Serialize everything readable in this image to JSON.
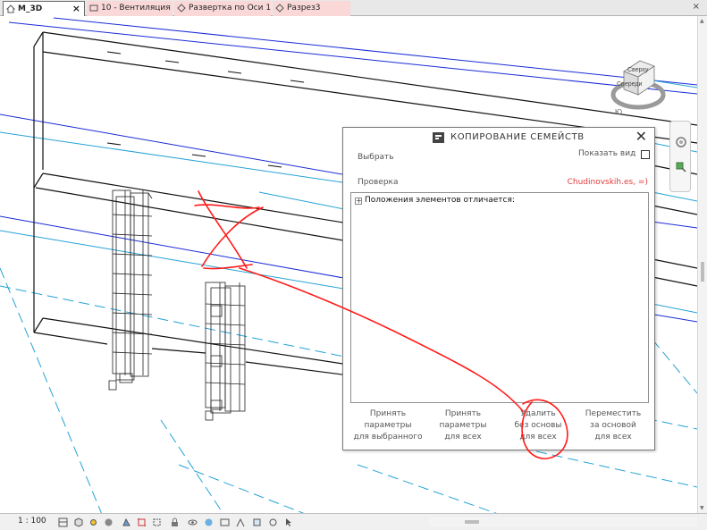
{
  "tabs": [
    {
      "label": "M_3D",
      "active": true
    },
    {
      "label": "10 - Вентиляция",
      "active": false
    },
    {
      "label": "Развертка по Оси 1",
      "active": false
    },
    {
      "label": "Разрез3",
      "active": false
    }
  ],
  "tab_close_glyph": "×",
  "viewcube": {
    "top_label": "Сверху",
    "front_label": "Спереди",
    "compass_label": "Ю"
  },
  "dialog": {
    "title": "КОПИРОВАНИЕ СЕМЕЙСТВ",
    "close_glyph": "✕",
    "select_label": "Выбрать",
    "show_view_label": "Показать вид",
    "show_view_checked": false,
    "check_label": "Проверка",
    "author": "Chudinovskih.es, =)",
    "tree": {
      "expander": "+",
      "node": "Положения элементов отличается:"
    },
    "buttons": [
      {
        "lines": [
          "Принять",
          "параметры",
          "для выбранного"
        ]
      },
      {
        "lines": [
          "Принять",
          "параметры",
          "для всех"
        ]
      },
      {
        "lines": [
          "Удалить",
          "без основы",
          "для всех"
        ]
      },
      {
        "lines": [
          "Переместить",
          "за основой",
          "для всех"
        ]
      }
    ]
  },
  "status": {
    "scale": "1 : 100"
  },
  "colors": {
    "accent_red": "#e13c3c",
    "markup_red": "#ff1a1a",
    "blue_line": "#1a2bd6",
    "cyan_line": "#25a3d6",
    "tab_inactive": "#fad8d8"
  },
  "icons": [
    "home-icon",
    "view-icon",
    "view-icon",
    "sync-icon",
    "close-icon",
    "logo-icon",
    "checkbox-icon",
    "expander-icon",
    "scale-icon",
    "detail-level-icon",
    "visual-style-icon",
    "sun-icon",
    "shadow-icon",
    "crop-icon",
    "hide-icon",
    "isolate-icon",
    "temporary-hide-icon",
    "reveal-icon",
    "lock-icon",
    "workset-icon",
    "analytical-icon",
    "highlight-icon"
  ]
}
